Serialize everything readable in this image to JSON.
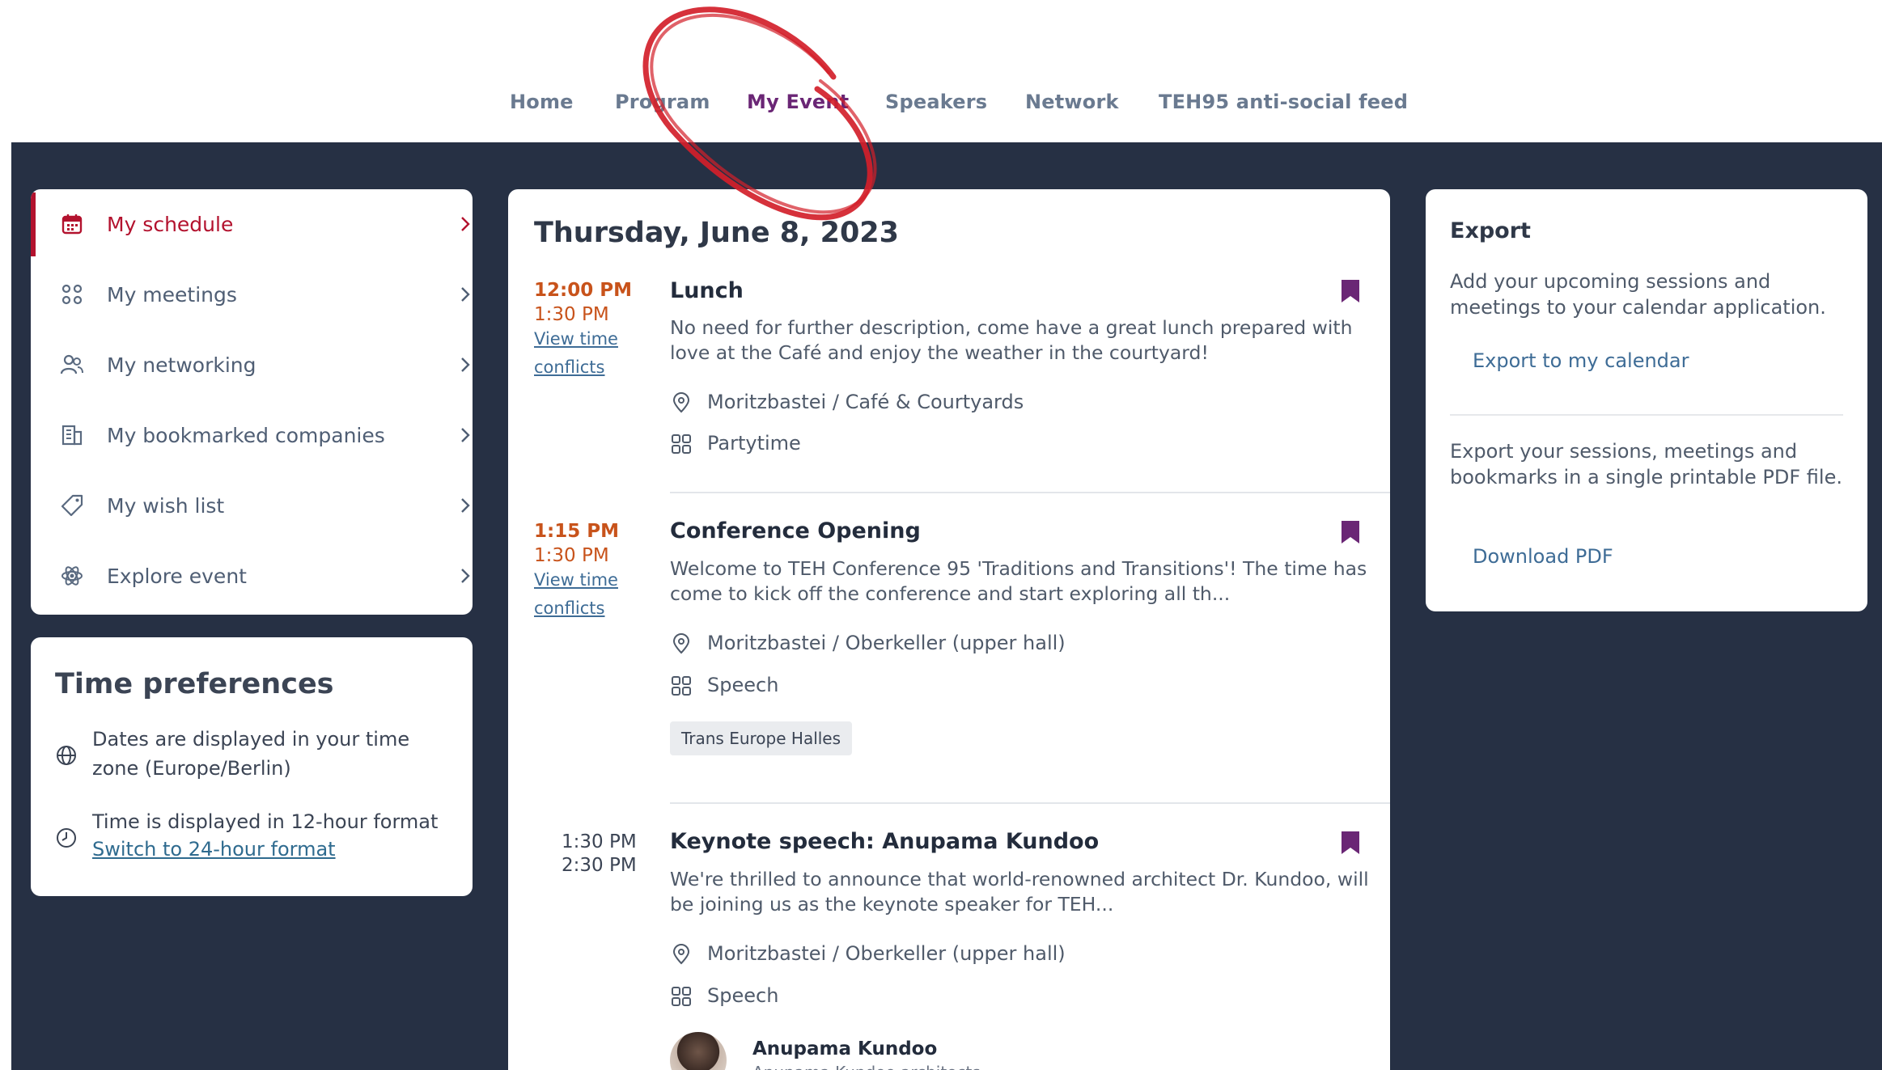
{
  "nav": {
    "items": [
      {
        "label": "Home"
      },
      {
        "label": "Program"
      },
      {
        "label": "My Event"
      },
      {
        "label": "Speakers"
      },
      {
        "label": "Network"
      },
      {
        "label": "TEH95 anti-social feed"
      }
    ],
    "active": "My Event"
  },
  "sidebar": {
    "items": [
      {
        "label": "My schedule",
        "icon": "calendar-icon"
      },
      {
        "label": "My meetings",
        "icon": "meetings-icon"
      },
      {
        "label": "My networking",
        "icon": "people-icon"
      },
      {
        "label": "My bookmarked companies",
        "icon": "building-icon"
      },
      {
        "label": "My wish list",
        "icon": "tag-icon"
      },
      {
        "label": "Explore event",
        "icon": "atom-icon"
      }
    ]
  },
  "time_prefs": {
    "title": "Time preferences",
    "timezone_text": "Dates are displayed in your time zone (Europe/Berlin)",
    "format_text": "Time is displayed in 12-hour format",
    "switch_link": "Switch to 24-hour format"
  },
  "schedule": {
    "date": "Thursday, June 8, 2023",
    "sessions": [
      {
        "start": "12:00 PM",
        "end": "1:30 PM",
        "conflicts_link": "View time conflicts",
        "title": "Lunch",
        "description": "No need for further description, come have a great lunch prepared with love at the Café and enjoy the weather in the courtyard!",
        "location": "Moritzbastei / Café & Courtyards",
        "category": "Partytime"
      },
      {
        "start": "1:15 PM",
        "end": "1:30 PM",
        "conflicts_link": "View time conflicts",
        "title": "Conference Opening",
        "description": "Welcome to TEH Conference 95 'Traditions and Transitions'! The time has come to kick off the conference and start exploring all th...",
        "location": "Moritzbastei / Oberkeller (upper hall)",
        "category": "Speech",
        "tag": "Trans Europe Halles"
      },
      {
        "start": "1:30 PM",
        "end": "2:30 PM",
        "title": "Keynote speech: Anupama Kundoo",
        "description": "We're thrilled to announce that world-renowned architect Dr. Kundoo, will be joining us as the keynote speaker for TEH...",
        "location": "Moritzbastei / Oberkeller (upper hall)",
        "category": "Speech",
        "speaker_name": "Anupama Kundoo",
        "speaker_org": "Anupama Kundoo architects"
      }
    ]
  },
  "export": {
    "title": "Export",
    "calendar_text": "Add your upcoming sessions and meetings to your calendar application.",
    "calendar_link": "Export to my calendar",
    "pdf_text": "Export your sessions, meetings and bookmarks in a single printable PDF file.",
    "pdf_link": "Download PDF"
  },
  "colors": {
    "accent_purple": "#6a2675",
    "active_red": "#b3122e",
    "time_orange": "#c8531b",
    "link_blue": "#3e6c96",
    "dark_background": "#263044",
    "annotation_red": "#d3202a"
  }
}
